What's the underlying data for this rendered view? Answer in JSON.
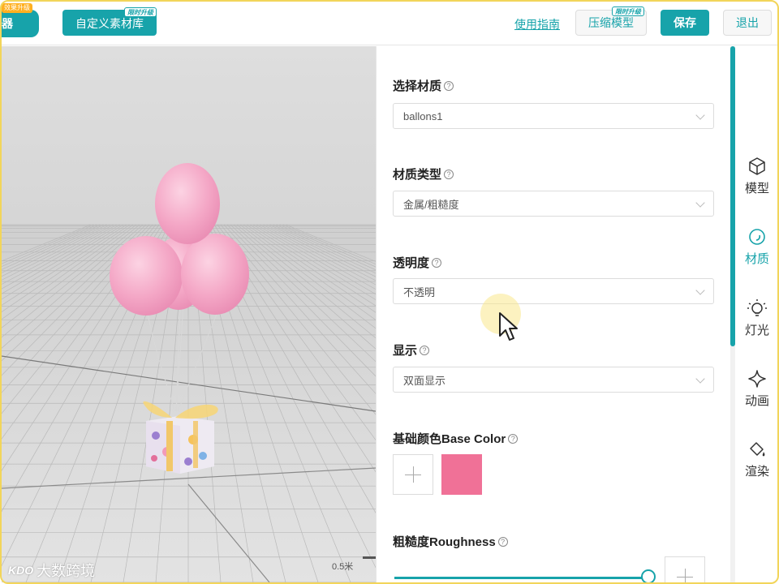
{
  "topbar": {
    "logo_text": "器",
    "logo_badge": "效果升级",
    "custom_lib_label": "自定义素材库",
    "custom_lib_badge": "限时升级",
    "guide_label": "使用指南",
    "compress_label": "压缩模型",
    "compress_badge": "限时升级",
    "save_label": "保存",
    "exit_label": "退出"
  },
  "viewport": {
    "scale_label": "0.5米",
    "watermark": "大数跨境",
    "watermark_logo": "KDO"
  },
  "panel": {
    "material": {
      "title": "选择材质",
      "value": "ballons1"
    },
    "material_type": {
      "title": "材质类型",
      "value": "金属/粗糙度"
    },
    "opacity": {
      "title": "透明度",
      "value": "不透明"
    },
    "display": {
      "title": "显示",
      "value": "双面显示"
    },
    "base_color": {
      "title": "基础颜色Base Color",
      "swatch_color": "#f07197"
    },
    "roughness": {
      "title": "粗糙度Roughness",
      "value_fraction": 0.97
    }
  },
  "help_glyph": "?",
  "tabs": [
    {
      "label": "模型",
      "icon": "cube-icon",
      "active": false
    },
    {
      "label": "材质",
      "icon": "material-circle-icon",
      "active": true
    },
    {
      "label": "灯光",
      "icon": "bulb-icon",
      "active": false
    },
    {
      "label": "动画",
      "icon": "sparkle-icon",
      "active": false
    },
    {
      "label": "渲染",
      "icon": "paint-bucket-icon",
      "active": false
    }
  ],
  "colors": {
    "accent": "#17a3aa",
    "balloon": "#f4a7c6"
  }
}
